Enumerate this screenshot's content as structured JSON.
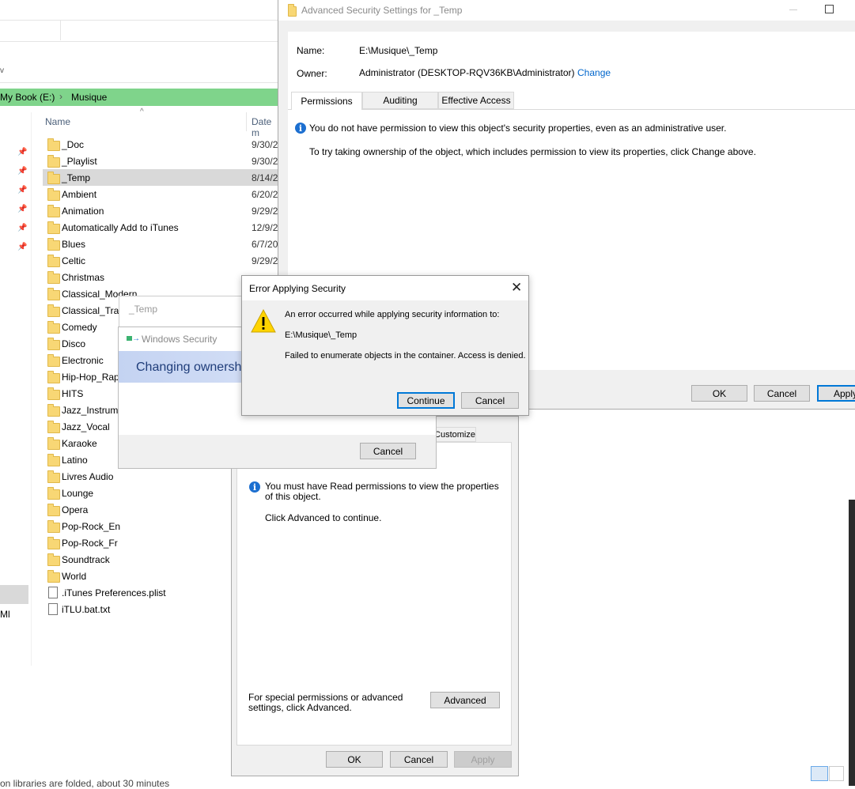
{
  "explorer": {
    "breadcrumb": [
      "My Book (E:)",
      "Musique"
    ],
    "col_name": "Name",
    "col_date": "Date m",
    "files": [
      {
        "name": "_Doc",
        "date": "9/30/2",
        "type": "folder"
      },
      {
        "name": "_Playlist",
        "date": "9/30/2",
        "type": "folder"
      },
      {
        "name": "_Temp",
        "date": "8/14/2",
        "type": "folder",
        "selected": true
      },
      {
        "name": "Ambient",
        "date": "6/20/2",
        "type": "folder"
      },
      {
        "name": "Animation",
        "date": "9/29/2",
        "type": "folder"
      },
      {
        "name": "Automatically Add to iTunes",
        "date": "12/9/2",
        "type": "folder"
      },
      {
        "name": "Blues",
        "date": "6/7/20",
        "type": "folder"
      },
      {
        "name": "Celtic",
        "date": "9/29/2",
        "type": "folder"
      },
      {
        "name": "Christmas",
        "date": "",
        "type": "folder"
      },
      {
        "name": "Classical_Modern",
        "date": "",
        "type": "folder"
      },
      {
        "name": "Classical_Tradi",
        "date": "",
        "type": "folder"
      },
      {
        "name": "Comedy",
        "date": "",
        "type": "folder"
      },
      {
        "name": "Disco",
        "date": "",
        "type": "folder"
      },
      {
        "name": "Electronic",
        "date": "",
        "type": "folder"
      },
      {
        "name": "Hip-Hop_Rap",
        "date": "",
        "type": "folder"
      },
      {
        "name": "HITS",
        "date": "",
        "type": "folder"
      },
      {
        "name": "Jazz_Instrume",
        "date": "",
        "type": "folder"
      },
      {
        "name": "Jazz_Vocal",
        "date": "",
        "type": "folder"
      },
      {
        "name": "Karaoke",
        "date": "",
        "type": "folder"
      },
      {
        "name": "Latino",
        "date": "",
        "type": "folder"
      },
      {
        "name": "Livres Audio",
        "date": "",
        "type": "folder"
      },
      {
        "name": "Lounge",
        "date": "",
        "type": "folder"
      },
      {
        "name": "Opera",
        "date": "",
        "type": "folder"
      },
      {
        "name": "Pop-Rock_En",
        "date": "",
        "type": "folder"
      },
      {
        "name": "Pop-Rock_Fr",
        "date": "",
        "type": "folder"
      },
      {
        "name": "Soundtrack",
        "date": "",
        "type": "folder"
      },
      {
        "name": "World",
        "date": "",
        "type": "folder"
      },
      {
        "name": ".iTunes Preferences.plist",
        "date": "",
        "type": "plist"
      },
      {
        "name": "iTLU.bat.txt",
        "date": "",
        "type": "txt"
      }
    ],
    "left_text": "Ml",
    "bottom_text": "on libraries are folded, about 30 minutes"
  },
  "advanced": {
    "title": "Advanced Security Settings for _Temp",
    "name_label": "Name:",
    "name_value": "E:\\Musique\\_Temp",
    "owner_label": "Owner:",
    "owner_value": "Administrator (DESKTOP-RQV36KB\\Administrator)",
    "change_link": "Change",
    "tabs": [
      "Permissions",
      "Auditing",
      "Effective Access"
    ],
    "info_text": "You do not have permission to view this object's security properties, even as an administrative user.",
    "hint_text": "To try taking ownership of the object, which includes permission to view its properties, click Change above.",
    "ok": "OK",
    "cancel": "Cancel",
    "apply": "Apply"
  },
  "properties": {
    "tab_customize": "Customize",
    "info_text": "You must have Read permissions to view the properties of this object.",
    "click_advanced": "Click Advanced to continue.",
    "special_text": "For special permissions or advanced settings, click Advanced.",
    "advanced_button": "Advanced",
    "ok": "OK",
    "cancel": "Cancel",
    "apply": "Apply"
  },
  "temp_dialog": {
    "title": "_Temp"
  },
  "windows_security": {
    "title": "Windows Security",
    "banner": "Changing ownershi",
    "cancel": "Cancel"
  },
  "error_dialog": {
    "title": "Error Applying Security",
    "line1": "An error occurred while applying security information to:",
    "line2": "E:\\Musique\\_Temp",
    "line3": "Failed to enumerate objects in the container. Access is denied.",
    "continue": "Continue",
    "cancel": "Cancel"
  }
}
